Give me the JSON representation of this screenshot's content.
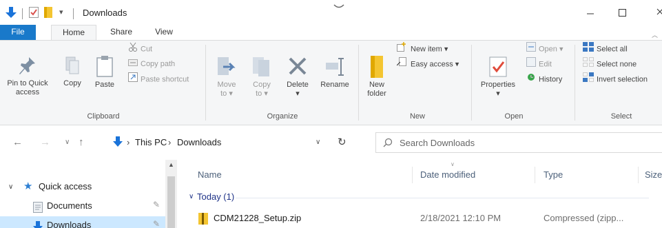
{
  "window": {
    "title": "Downloads",
    "quick_access_toolbar_caret": "▾"
  },
  "ribbon_tabs": [
    "File",
    "Home",
    "Share",
    "View"
  ],
  "ribbon": {
    "clipboard": {
      "pin_label_1": "Pin to Quick",
      "pin_label_2": "access",
      "copy": "Copy",
      "paste": "Paste",
      "cut": "Cut",
      "copy_path": "Copy path",
      "paste_shortcut": "Paste shortcut",
      "group": "Clipboard"
    },
    "organize": {
      "move_to_1": "Move",
      "move_to_2": "to",
      "copy_to_1": "Copy",
      "copy_to_2": "to",
      "delete": "Delete",
      "rename": "Rename",
      "group": "Organize"
    },
    "new": {
      "new_folder_1": "New",
      "new_folder_2": "folder",
      "new_item": "New item",
      "easy_access": "Easy access",
      "group": "New"
    },
    "open": {
      "properties": "Properties",
      "open": "Open",
      "edit": "Edit",
      "history": "History",
      "group": "Open"
    },
    "select": {
      "select_all": "Select all",
      "select_none": "Select none",
      "invert_selection": "Invert selection",
      "group": "Select"
    }
  },
  "address": {
    "crumbs": [
      "This PC",
      "Downloads"
    ],
    "search_placeholder": "Search Downloads"
  },
  "nav_pane": {
    "items": [
      "Quick access",
      "Documents",
      "Downloads"
    ]
  },
  "content": {
    "columns": [
      "Name",
      "Date modified",
      "Type",
      "Size"
    ],
    "group": "Today (1)",
    "files": [
      {
        "name": "CDM21228_Setup.zip",
        "date": "2/18/2021 12:10 PM",
        "type": "Compressed (zipp..."
      }
    ]
  },
  "colors": {
    "accent": "#1979ca",
    "selection": "#cce8ff",
    "folder": "#f4c531"
  }
}
